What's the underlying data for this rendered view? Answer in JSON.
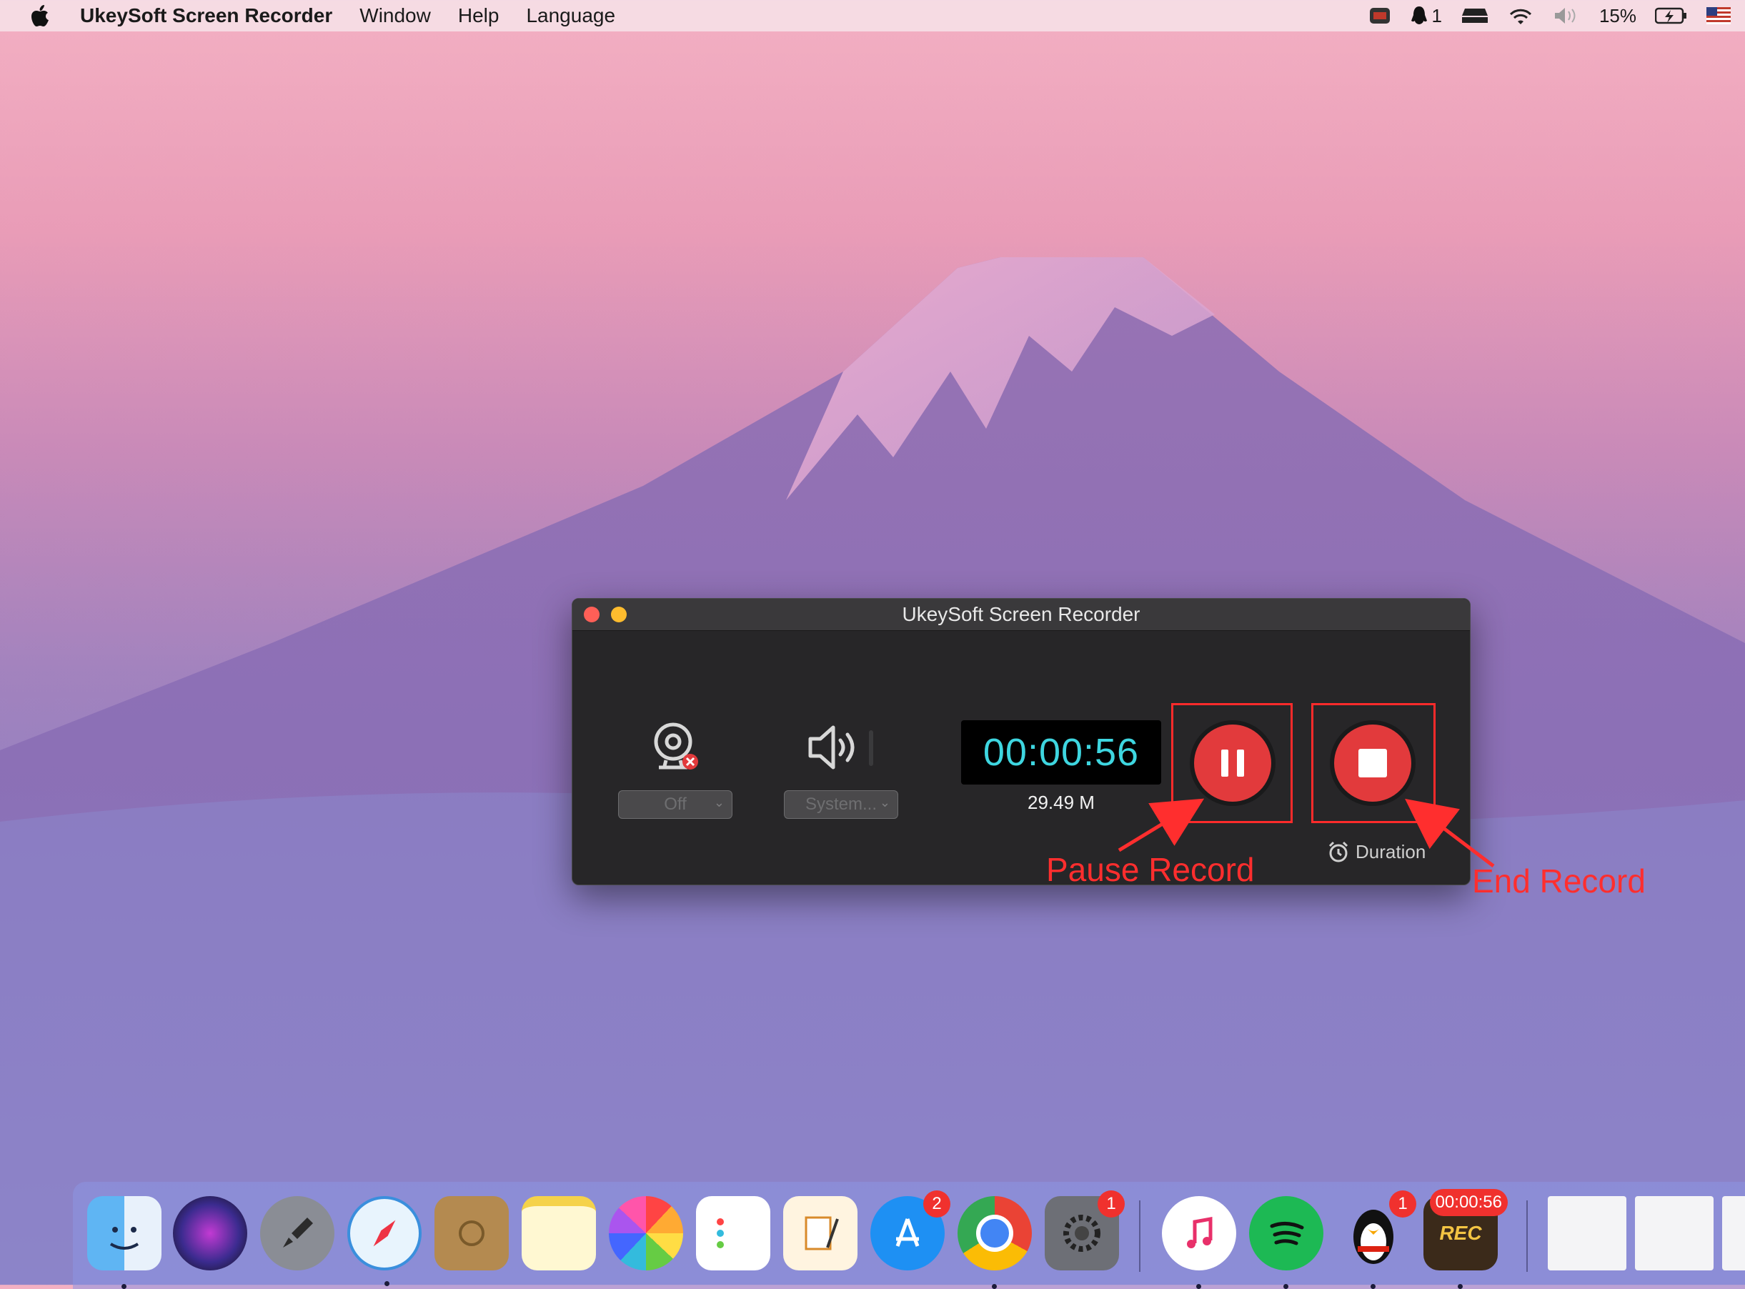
{
  "menubar": {
    "app_name": "UkeySoft Screen Recorder",
    "items": [
      "Window",
      "Help",
      "Language"
    ],
    "notification_count": "1",
    "battery": "15%"
  },
  "window": {
    "title": "UkeySoft Screen Recorder",
    "webcam_select": "Off",
    "audio_select": "System...",
    "timer": "00:00:56",
    "file_size": "29.49 M",
    "duration_label": "Duration"
  },
  "annotations": {
    "pause": "Pause Record",
    "end": "End Record"
  },
  "dock": {
    "items": [
      {
        "name": "Finder",
        "icon": "finder-icon"
      },
      {
        "name": "Siri",
        "icon": "siri-icon"
      },
      {
        "name": "Launchpad",
        "icon": "rocket-icon"
      },
      {
        "name": "Safari",
        "icon": "compass-icon"
      },
      {
        "name": "Contacts",
        "icon": "contacts-icon"
      },
      {
        "name": "Notes",
        "icon": "notes-icon"
      },
      {
        "name": "Photos",
        "icon": "photos-icon"
      },
      {
        "name": "Reminders",
        "icon": "reminders-icon"
      },
      {
        "name": "Pages",
        "icon": "pages-icon"
      },
      {
        "name": "App Store",
        "icon": "appstore-icon",
        "badge": "2"
      },
      {
        "name": "Chrome",
        "icon": "chrome-icon"
      },
      {
        "name": "System Preferences",
        "icon": "gear-icon",
        "badge": "1"
      },
      {
        "name": "iTunes",
        "icon": "music-icon"
      },
      {
        "name": "Spotify",
        "icon": "spotify-icon"
      },
      {
        "name": "QQ",
        "icon": "penguin-icon",
        "badge": "1"
      },
      {
        "name": "UkeySoft Screen Recorder",
        "icon": "rec-icon",
        "badge": "00:00:56"
      }
    ]
  },
  "colors": {
    "record_red": "#e23a3c",
    "timer_cyan": "#3ed6e0",
    "annotation_red": "#ff2e2e"
  }
}
